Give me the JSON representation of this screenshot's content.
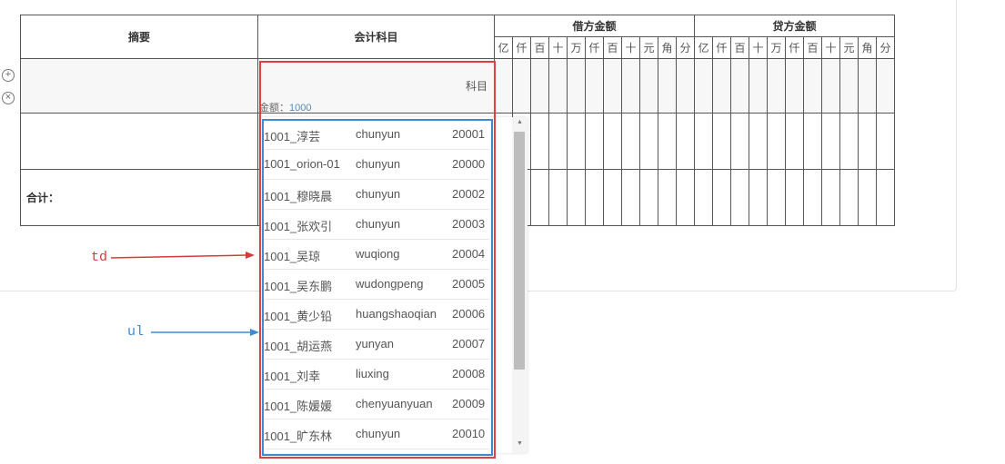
{
  "headers": {
    "summary": "摘要",
    "account": "会计科目",
    "debit": "借方金额",
    "credit": "贷方金额"
  },
  "digits": [
    "亿",
    "仟",
    "百",
    "十",
    "万",
    "仟",
    "百",
    "十",
    "元",
    "角",
    "分"
  ],
  "total_label": "合计：",
  "subject_label": "科目",
  "amount": {
    "label": "金额：",
    "value": "1000"
  },
  "controls": {
    "add": "+",
    "remove": "×"
  },
  "dropdown_items": [
    {
      "code": "1001_淳芸",
      "pinyin": "chunyun",
      "number": "20001"
    },
    {
      "code": "1001_orion-01",
      "pinyin": "chunyun",
      "number": "20000"
    },
    {
      "code": "1001_穆晓晨",
      "pinyin": "chunyun",
      "number": "20002"
    },
    {
      "code": "1001_张欢引",
      "pinyin": "chunyun",
      "number": "20003"
    },
    {
      "code": "1001_吴琼",
      "pinyin": "wuqiong",
      "number": "20004"
    },
    {
      "code": "1001_吴东鹏",
      "pinyin": "wudongpeng",
      "number": "20005"
    },
    {
      "code": "1001_黄少铅",
      "pinyin": "huangshaoqian",
      "number": "20006"
    },
    {
      "code": "1001_胡运燕",
      "pinyin": "yunyan",
      "number": "20007"
    },
    {
      "code": "1001_刘幸",
      "pinyin": "liuxing",
      "number": "20008"
    },
    {
      "code": "1001_陈媛媛",
      "pinyin": "chenyuanyuan",
      "number": "20009"
    },
    {
      "code": "1001_旷东林",
      "pinyin": "chunyun",
      "number": "20010"
    }
  ],
  "annotations": {
    "td": "td",
    "ul": "ul"
  },
  "colors": {
    "td_box": "#e04040",
    "ul_box": "#3d8bd5",
    "blue_divider": "#4a90c8",
    "gold_divider": "#e6b422"
  }
}
